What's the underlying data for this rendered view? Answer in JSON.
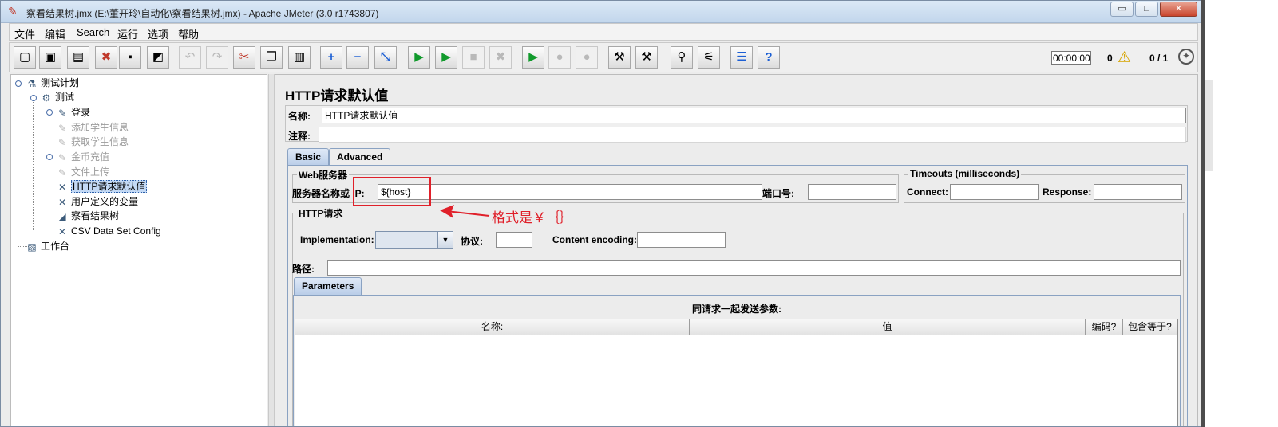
{
  "window": {
    "title": "察看结果树.jmx (E:\\董开玲\\自动化\\察看结果树.jmx) - Apache JMeter (3.0 r1743807)",
    "controls": {
      "minimize": "▭",
      "maximize": "□",
      "close": "✕"
    }
  },
  "menu": [
    "文件",
    "编辑",
    "Search",
    "运行",
    "选项",
    "帮助"
  ],
  "toolbar": {
    "buttons": [
      {
        "name": "new-icon",
        "glyph": "▢",
        "enabled": true
      },
      {
        "name": "templates-icon",
        "glyph": "▣",
        "enabled": true
      },
      {
        "name": "open-icon",
        "glyph": "▤",
        "enabled": true
      },
      {
        "name": "close-icon",
        "glyph": "✖",
        "enabled": true
      },
      {
        "name": "save-icon",
        "glyph": "▪",
        "enabled": true
      },
      {
        "name": "save-as-icon",
        "glyph": "◩",
        "enabled": true
      },
      {
        "name": "undo-icon",
        "glyph": "↶",
        "enabled": false
      },
      {
        "name": "redo-icon",
        "glyph": "↷",
        "enabled": false
      },
      {
        "name": "cut-icon",
        "glyph": "✂",
        "enabled": true
      },
      {
        "name": "copy-icon",
        "glyph": "❐",
        "enabled": true
      },
      {
        "name": "paste-icon",
        "glyph": "▥",
        "enabled": true
      },
      {
        "name": "expand-icon",
        "glyph": "+",
        "enabled": true
      },
      {
        "name": "collapse-icon",
        "glyph": "−",
        "enabled": true
      },
      {
        "name": "toggle-icon",
        "glyph": "⤡",
        "enabled": true
      },
      {
        "name": "start-icon",
        "glyph": "▶",
        "enabled": true
      },
      {
        "name": "start-no-pause-icon",
        "glyph": "▶",
        "enabled": true
      },
      {
        "name": "stop-icon",
        "glyph": "■",
        "enabled": false
      },
      {
        "name": "shutdown-icon",
        "glyph": "✖",
        "enabled": false
      },
      {
        "name": "remote-start-icon",
        "glyph": "▶",
        "enabled": true
      },
      {
        "name": "remote-stop-icon",
        "glyph": "●",
        "enabled": false
      },
      {
        "name": "remote-shutdown-icon",
        "glyph": "●",
        "enabled": false
      },
      {
        "name": "clear-icon",
        "glyph": "⚒",
        "enabled": true
      },
      {
        "name": "clear-all-icon",
        "glyph": "⚒",
        "enabled": true
      },
      {
        "name": "search-icon",
        "glyph": "⚲",
        "enabled": true
      },
      {
        "name": "reset-search-icon",
        "glyph": "⚟",
        "enabled": true
      },
      {
        "name": "function-helper-icon",
        "glyph": "☰",
        "enabled": true
      },
      {
        "name": "help-icon",
        "glyph": "?",
        "enabled": true
      }
    ],
    "timer": "00:00:00",
    "error_count": "0",
    "threads": "0 / 1"
  },
  "tree": {
    "nodes": [
      {
        "label": "测试计划",
        "icon": "test-plan-icon",
        "glyph": "⚗",
        "disabled": false
      },
      {
        "label": "测试",
        "icon": "thread-group-icon",
        "glyph": "⚙",
        "disabled": false
      },
      {
        "label": "登录",
        "icon": "sampler-icon",
        "glyph": "✎",
        "disabled": false
      },
      {
        "label": "添加学生信息",
        "icon": "sampler-icon",
        "glyph": "✎",
        "disabled": true
      },
      {
        "label": "获取学生信息",
        "icon": "sampler-icon",
        "glyph": "✎",
        "disabled": true
      },
      {
        "label": "金币充值",
        "icon": "sampler-icon",
        "glyph": "✎",
        "disabled": true
      },
      {
        "label": "文件上传",
        "icon": "sampler-icon",
        "glyph": "✎",
        "disabled": true
      },
      {
        "label": "HTTP请求默认值",
        "icon": "config-element-icon",
        "glyph": "✕",
        "disabled": false,
        "selected": true
      },
      {
        "label": "用户定义的变量",
        "icon": "config-element-icon",
        "glyph": "✕",
        "disabled": false
      },
      {
        "label": "察看结果树",
        "icon": "listener-icon",
        "glyph": "◢",
        "disabled": false
      },
      {
        "label": "CSV Data Set Config",
        "icon": "config-element-icon",
        "glyph": "✕",
        "disabled": false
      },
      {
        "label": "工作台",
        "icon": "workbench-icon",
        "glyph": "▧",
        "disabled": false
      }
    ]
  },
  "editor": {
    "title": "HTTP请求默认值",
    "name_label": "名称:",
    "name_value": "HTTP请求默认值",
    "comment_label": "注释:",
    "comment_value": "",
    "tabs": [
      "Basic",
      "Advanced"
    ],
    "web_server": {
      "group_title": "Web服务器",
      "server_label": "服务器名称或 IP:",
      "server_value": "${host}",
      "port_label": "端口号:",
      "port_value": ""
    },
    "timeouts": {
      "group_title": "Timeouts (milliseconds)",
      "connect_label": "Connect:",
      "connect_value": "",
      "response_label": "Response:",
      "response_value": ""
    },
    "http_request": {
      "group_title": "HTTP请求",
      "implementation_label": "Implementation:",
      "implementation_value": "",
      "protocol_label": "协议:",
      "protocol_value": "",
      "encoding_label": "Content encoding:",
      "encoding_value": "",
      "path_label": "路径:",
      "path_value": ""
    },
    "parameters": {
      "tab": "Parameters",
      "caption": "同请求一起发送参数:",
      "columns": [
        "名称:",
        "值",
        "编码?",
        "包含等于?"
      ]
    }
  },
  "annotation": {
    "text": "格式是￥｛｝",
    "color": "#e0202a"
  }
}
